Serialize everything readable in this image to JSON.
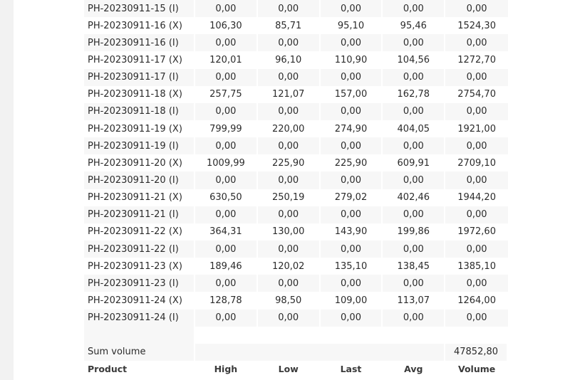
{
  "table": {
    "rows": [
      {
        "product": "PH-20230911-15 (I)",
        "high": "0,00",
        "low": "0,00",
        "last": "0,00",
        "avg": "0,00",
        "volume": "0,00"
      },
      {
        "product": "PH-20230911-16 (X)",
        "high": "106,30",
        "low": "85,71",
        "last": "95,10",
        "avg": "95,46",
        "volume": "1524,30"
      },
      {
        "product": "PH-20230911-16 (I)",
        "high": "0,00",
        "low": "0,00",
        "last": "0,00",
        "avg": "0,00",
        "volume": "0,00"
      },
      {
        "product": "PH-20230911-17 (X)",
        "high": "120,01",
        "low": "96,10",
        "last": "110,90",
        "avg": "104,56",
        "volume": "1272,70"
      },
      {
        "product": "PH-20230911-17 (I)",
        "high": "0,00",
        "low": "0,00",
        "last": "0,00",
        "avg": "0,00",
        "volume": "0,00"
      },
      {
        "product": "PH-20230911-18 (X)",
        "high": "257,75",
        "low": "121,07",
        "last": "157,00",
        "avg": "162,78",
        "volume": "2754,70"
      },
      {
        "product": "PH-20230911-18 (I)",
        "high": "0,00",
        "low": "0,00",
        "last": "0,00",
        "avg": "0,00",
        "volume": "0,00"
      },
      {
        "product": "PH-20230911-19 (X)",
        "high": "799,99",
        "low": "220,00",
        "last": "274,90",
        "avg": "404,05",
        "volume": "1921,00"
      },
      {
        "product": "PH-20230911-19 (I)",
        "high": "0,00",
        "low": "0,00",
        "last": "0,00",
        "avg": "0,00",
        "volume": "0,00"
      },
      {
        "product": "PH-20230911-20 (X)",
        "high": "1009,99",
        "low": "225,90",
        "last": "225,90",
        "avg": "609,91",
        "volume": "2709,10"
      },
      {
        "product": "PH-20230911-20 (I)",
        "high": "0,00",
        "low": "0,00",
        "last": "0,00",
        "avg": "0,00",
        "volume": "0,00"
      },
      {
        "product": "PH-20230911-21 (X)",
        "high": "630,50",
        "low": "250,19",
        "last": "279,02",
        "avg": "402,46",
        "volume": "1944,20"
      },
      {
        "product": "PH-20230911-21 (I)",
        "high": "0,00",
        "low": "0,00",
        "last": "0,00",
        "avg": "0,00",
        "volume": "0,00"
      },
      {
        "product": "PH-20230911-22 (X)",
        "high": "364,31",
        "low": "130,00",
        "last": "143,90",
        "avg": "199,86",
        "volume": "1972,60"
      },
      {
        "product": "PH-20230911-22 (I)",
        "high": "0,00",
        "low": "0,00",
        "last": "0,00",
        "avg": "0,00",
        "volume": "0,00"
      },
      {
        "product": "PH-20230911-23 (X)",
        "high": "189,46",
        "low": "120,02",
        "last": "135,10",
        "avg": "138,45",
        "volume": "1385,10"
      },
      {
        "product": "PH-20230911-23 (I)",
        "high": "0,00",
        "low": "0,00",
        "last": "0,00",
        "avg": "0,00",
        "volume": "0,00"
      },
      {
        "product": "PH-20230911-24 (X)",
        "high": "128,78",
        "low": "98,50",
        "last": "109,00",
        "avg": "113,07",
        "volume": "1264,00"
      },
      {
        "product": "PH-20230911-24 (I)",
        "high": "0,00",
        "low": "0,00",
        "last": "0,00",
        "avg": "0,00",
        "volume": "0,00"
      }
    ],
    "sum_label": "Sum volume",
    "sum_value": "47852,80",
    "headers": {
      "product": "Product",
      "high": "High",
      "low": "Low",
      "last": "Last",
      "avg": "Avg",
      "volume": "Volume"
    }
  }
}
